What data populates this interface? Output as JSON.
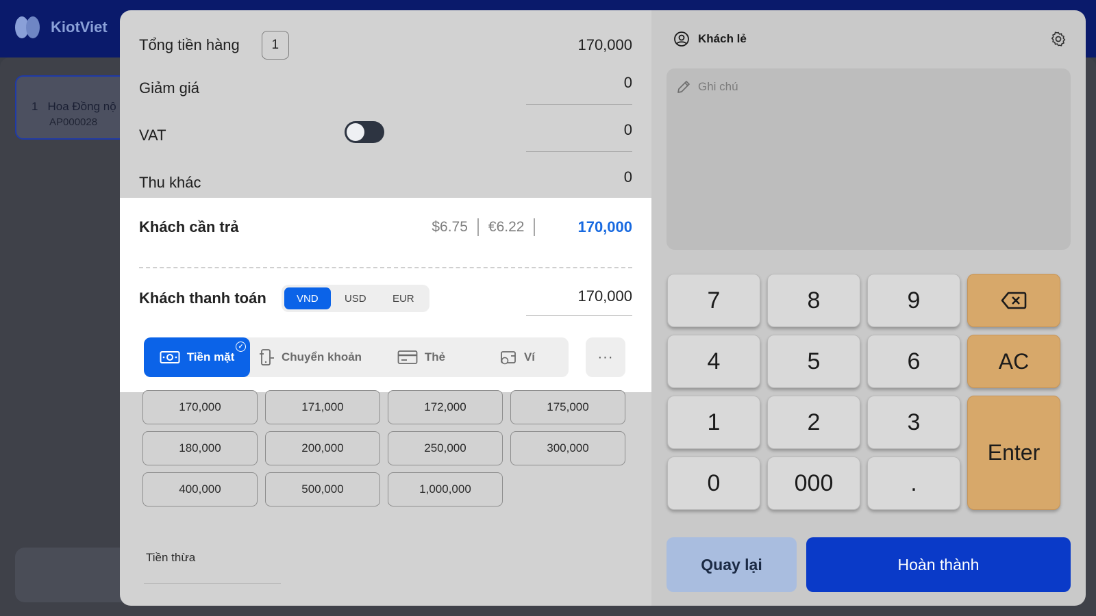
{
  "app": {
    "brand": "KiotViet"
  },
  "background": {
    "order_card": {
      "index": "1",
      "name": "Hoa Đồng nộ",
      "code": "AP000028"
    }
  },
  "summary": {
    "total_goods_label": "Tổng tiền hàng",
    "total_goods_qty": "1",
    "total_goods_value": "170,000",
    "discount_label": "Giảm giá",
    "discount_value": "0",
    "vat_label": "VAT",
    "vat_enabled": false,
    "vat_value": "0",
    "other_label": "Thu khác",
    "other_value": "0"
  },
  "due": {
    "label": "Khách cần trả",
    "usd": "$6.75",
    "eur": "€6.22",
    "total": "170,000"
  },
  "payment": {
    "label": "Khách thanh toán",
    "currencies": [
      "VND",
      "USD",
      "EUR"
    ],
    "active_currency": "VND",
    "amount": "170,000",
    "methods": [
      {
        "label": "Tiền mặt",
        "icon": "cash-icon",
        "active": true
      },
      {
        "label": "Chuyển khoản",
        "icon": "transfer-icon",
        "active": false
      },
      {
        "label": "Thẻ",
        "icon": "card-icon",
        "active": false
      },
      {
        "label": "Ví",
        "icon": "wallet-icon",
        "active": false
      }
    ],
    "more": "···"
  },
  "presets": [
    "170,000",
    "171,000",
    "172,000",
    "175,000",
    "180,000",
    "200,000",
    "250,000",
    "300,000",
    "400,000",
    "500,000",
    "1,000,000"
  ],
  "change": {
    "label": "Tiền thừa"
  },
  "customer": {
    "name": "Khách lẻ"
  },
  "note": {
    "placeholder": "Ghi chú"
  },
  "keypad": {
    "k7": "7",
    "k8": "8",
    "k9": "9",
    "k4": "4",
    "k5": "5",
    "k6": "6",
    "ac": "AC",
    "k1": "1",
    "k2": "2",
    "k3": "3",
    "enter": "Enter",
    "k0": "0",
    "k000": "000",
    "dot": "."
  },
  "actions": {
    "back": "Quay lại",
    "done": "Hoàn thành"
  },
  "colors": {
    "accent": "#0b63e8",
    "done": "#0a3ac8",
    "back": "#a9bddf",
    "keypad_orange": "#d7a86a",
    "due_total": "#1769e0"
  }
}
